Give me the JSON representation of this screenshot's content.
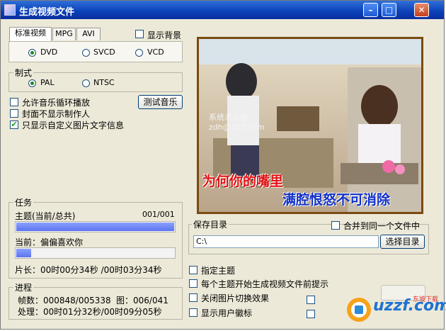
{
  "window": {
    "title": "生成视频文件"
  },
  "tabs": [
    {
      "label": "标准视频"
    },
    {
      "label": "MPG"
    },
    {
      "label": "AVI"
    }
  ],
  "show_background": {
    "label": "显示背景",
    "checked": false
  },
  "disc_format": {
    "options": [
      "DVD",
      "SVCD",
      "VCD"
    ],
    "selected": "DVD"
  },
  "tv_system": {
    "label": "制式",
    "options": [
      "PAL",
      "NTSC"
    ],
    "selected": "PAL"
  },
  "options": {
    "loop_music": {
      "label": "允许音乐循环播放",
      "checked": false
    },
    "hide_author": {
      "label": "封面不显示制作人",
      "checked": false
    },
    "custom_caption_only": {
      "label": "只显示自定义图片文字信息",
      "checked": true
    },
    "check_mark": "✔"
  },
  "test_music_button": "测试音乐",
  "task": {
    "label": "任务",
    "theme_label": "主题(当前/总共)",
    "theme_count": "001/001",
    "theme_progress": 1.0,
    "current_label": "当前：偏偏喜欢你",
    "current_progress": 0.1,
    "length": "片长：00时00分34秒 /00时03分34秒"
  },
  "progress": {
    "label": "进程",
    "frames": "帧数：000848/005338",
    "images": "图：006/041",
    "processing": "处理：00时01分32秒/00时09分05秒"
  },
  "preview": {
    "watermark_line1": "系统未注册",
    "watermark_line2": "zdh@163.com",
    "lyric_line1": "为何你的嘴里",
    "lyric_line2": "满腔恨怒不可消除"
  },
  "save_dir": {
    "label": "保存目录",
    "merge_label": "合并到同一个文件中",
    "merge_checked": false,
    "path": "C:\\",
    "browse_button": "选择目录"
  },
  "bottom_options": {
    "specify_theme": {
      "label": "指定主题",
      "checked": false
    },
    "prompt_each": {
      "label": "每个主题开始生成视频文件前提示",
      "checked": false
    },
    "disable_transition": {
      "label": "关闭图片切换效果",
      "checked": false
    },
    "show_user_logo": {
      "label": "显示用户徽标",
      "checked": false
    }
  },
  "site_logo": {
    "text": "uzzf.com",
    "subtext": "东坡下载"
  },
  "colors": {
    "titlebar": "#0a3fb7",
    "progress_fill": "#6b80f5",
    "lyric_red": "#e01010",
    "lyric_blue": "#1030c8"
  }
}
